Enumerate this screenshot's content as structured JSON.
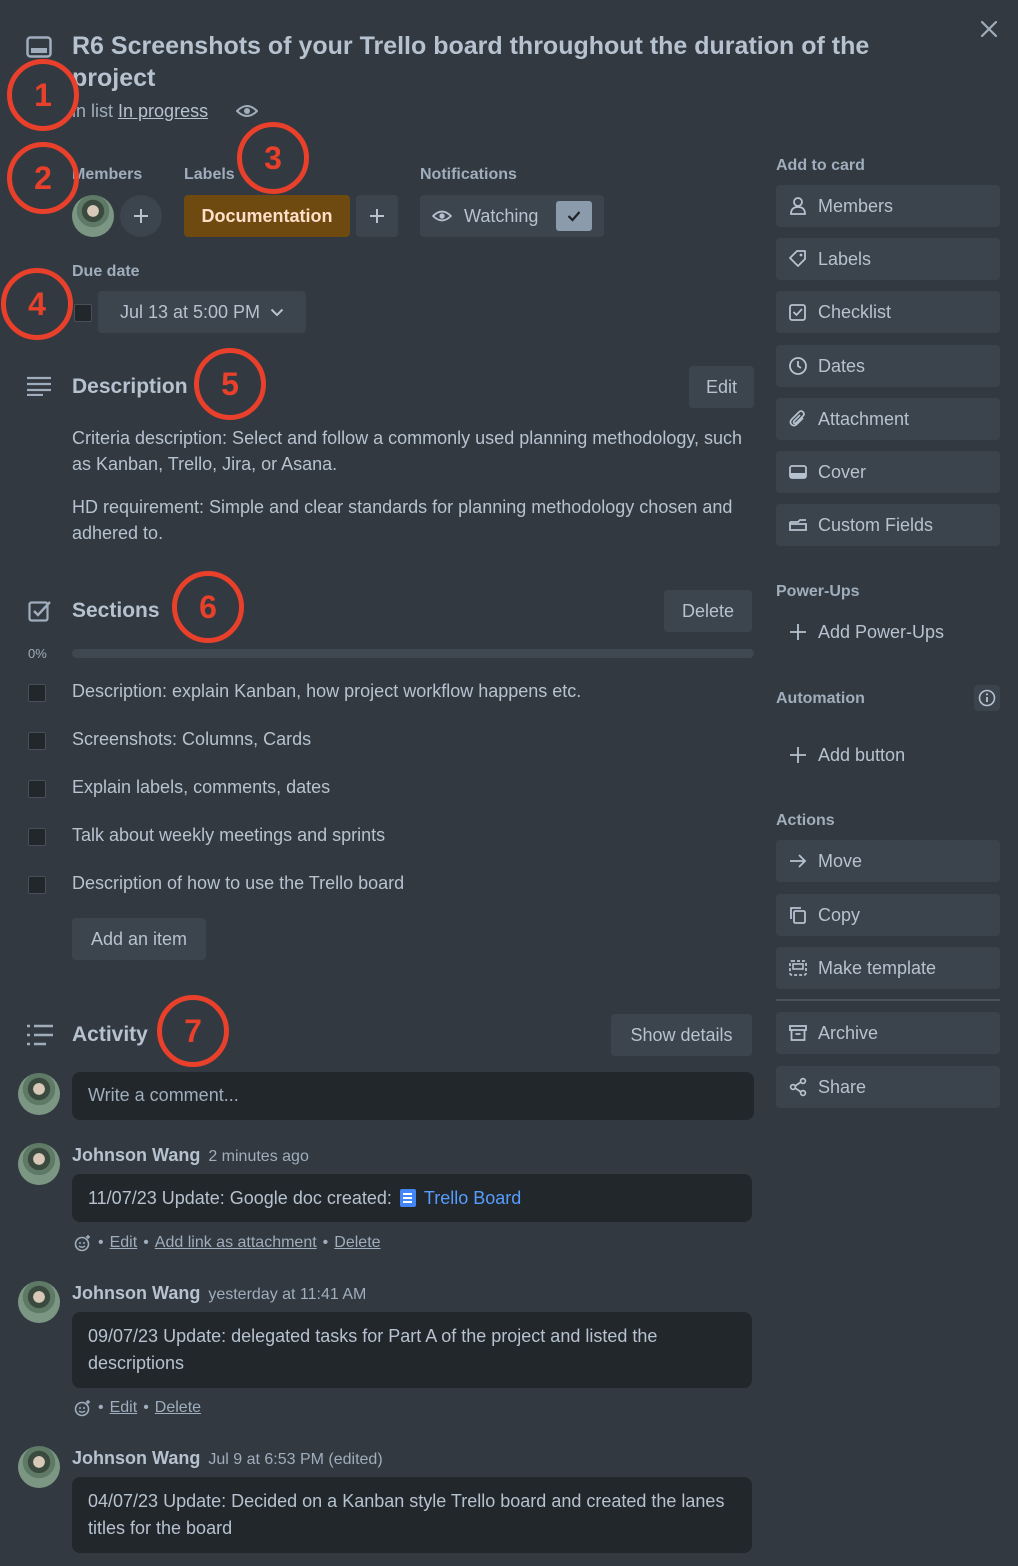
{
  "card": {
    "title": "R6 Screenshots of your Trello board throughout the duration of the project",
    "in_list_prefix": "in list",
    "list_name": "In progress"
  },
  "members": {
    "label": "Members"
  },
  "labels": {
    "label": "Labels",
    "chips": [
      "Documentation"
    ]
  },
  "notifications": {
    "label": "Notifications",
    "button": "Watching"
  },
  "due": {
    "label": "Due date",
    "value": "Jul 13 at 5:00 PM"
  },
  "description": {
    "title": "Description",
    "edit": "Edit",
    "p1": "Criteria description: Select and follow a commonly used planning methodology, such as Kanban, Trello, Jira, or Asana.",
    "p2": "HD requirement: Simple and clear standards for planning methodology chosen and adhered to."
  },
  "checklist": {
    "title": "Sections",
    "delete": "Delete",
    "progress_label": "0%",
    "progress": 0,
    "items": [
      "Description: explain Kanban, how project workflow happens etc.",
      "Screenshots: Columns, Cards",
      "Explain labels, comments, dates",
      "Talk about weekly meetings and sprints",
      "Description of how to use the Trello board"
    ],
    "add_item": "Add an item"
  },
  "activity": {
    "title": "Activity",
    "show_details": "Show details",
    "comment_placeholder": "Write a comment...",
    "comments": [
      {
        "author": "Johnson Wang",
        "time": "2 minutes ago",
        "text": "11/07/23 Update: Google doc created:",
        "link": "Trello Board",
        "actions": [
          "Edit",
          "Add link as attachment",
          "Delete"
        ]
      },
      {
        "author": "Johnson Wang",
        "time": "yesterday at 11:41 AM",
        "text": "09/07/23 Update: delegated tasks for Part A of the project and listed the descriptions",
        "actions": [
          "Edit",
          "Delete"
        ]
      },
      {
        "author": "Johnson Wang",
        "time": "Jul 9 at 6:53 PM (edited)",
        "text": "04/07/23 Update: Decided on a Kanban style Trello board and created the lanes titles for the board"
      }
    ]
  },
  "sidebar": {
    "add_to_card": "Add to card",
    "add_items": [
      "Members",
      "Labels",
      "Checklist",
      "Dates",
      "Attachment",
      "Cover",
      "Custom Fields"
    ],
    "powerups_title": "Power-Ups",
    "add_powerups": "Add Power-Ups",
    "automation_title": "Automation",
    "add_button": "Add button",
    "actions_title": "Actions",
    "actions": [
      "Move",
      "Copy",
      "Make template",
      "Archive",
      "Share"
    ]
  },
  "annotations": [
    "1",
    "2",
    "3",
    "4",
    "5",
    "6",
    "7"
  ],
  "colors": {
    "background": "#323940",
    "label_documentation": "#6f4a10",
    "annotation": "#e8402a",
    "link": "#579dff"
  }
}
